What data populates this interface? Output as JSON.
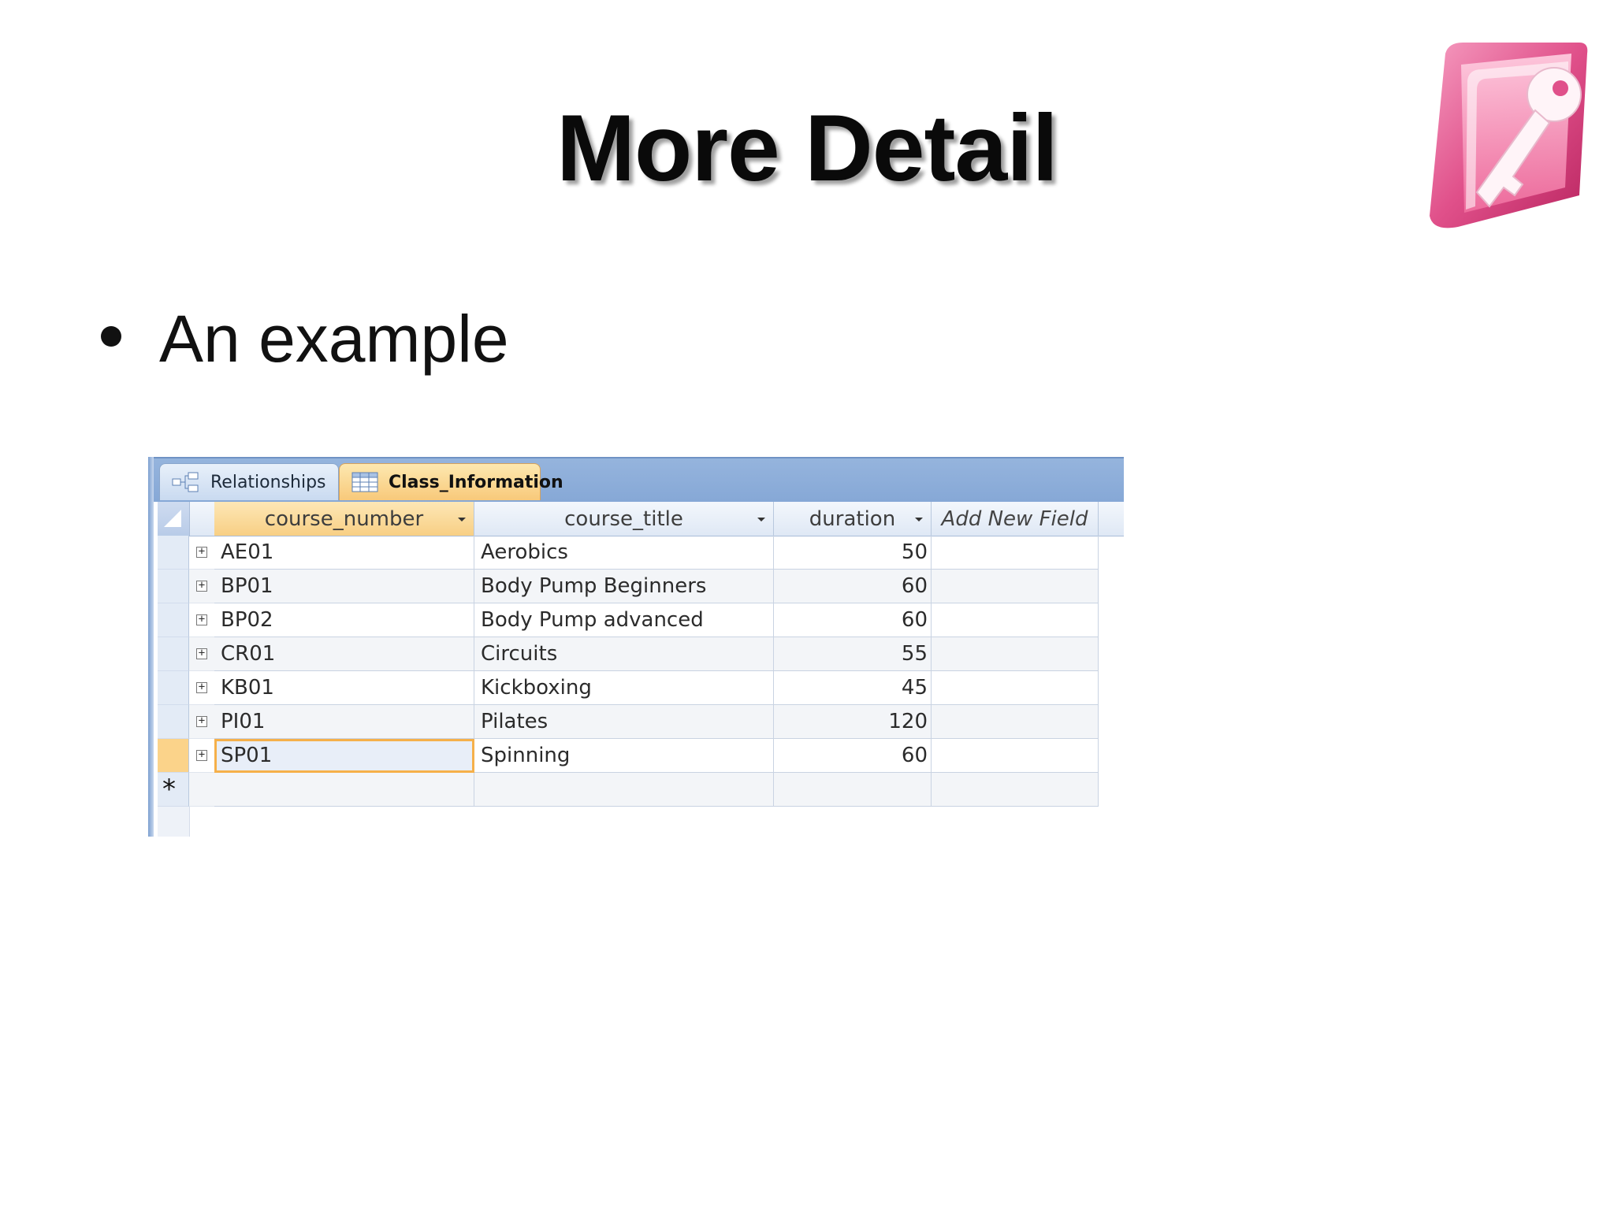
{
  "slide": {
    "title": "More Detail",
    "bullet": "An example"
  },
  "logo": {
    "name": "ms-access-key-logo",
    "colors": [
      "#d8407a",
      "#f07aa8",
      "#ffffff"
    ]
  },
  "tabs": [
    {
      "label": "Relationships",
      "icon": "relationships-icon",
      "active": false
    },
    {
      "label": "Class_Information",
      "icon": "datasheet-table-icon",
      "active": true
    }
  ],
  "columns": [
    {
      "label": "course_number",
      "has_dropdown": true
    },
    {
      "label": "course_title",
      "has_dropdown": true
    },
    {
      "label": "duration",
      "has_dropdown": true
    },
    {
      "label": "Add New Field",
      "has_dropdown": false
    }
  ],
  "rows": [
    {
      "course_number": "AE01",
      "course_title": "Aerobics",
      "duration": "50"
    },
    {
      "course_number": "BP01",
      "course_title": "Body Pump Beginners",
      "duration": "60"
    },
    {
      "course_number": "BP02",
      "course_title": "Body Pump advanced",
      "duration": "60"
    },
    {
      "course_number": "CR01",
      "course_title": "Circuits",
      "duration": "55"
    },
    {
      "course_number": "KB01",
      "course_title": "Kickboxing",
      "duration": "45"
    },
    {
      "course_number": "PI01",
      "course_title": "Pilates",
      "duration": "120"
    },
    {
      "course_number": "SP01",
      "course_title": "Spinning",
      "duration": "60"
    }
  ],
  "new_record_marker": "*",
  "expand_glyph": "+",
  "selected_row_index": 6,
  "colors": {
    "tab_bar": "#8aabd8",
    "active_tab": "#f8c97a",
    "selection": "#fbd38a",
    "focus_border": "#f5b04a"
  }
}
